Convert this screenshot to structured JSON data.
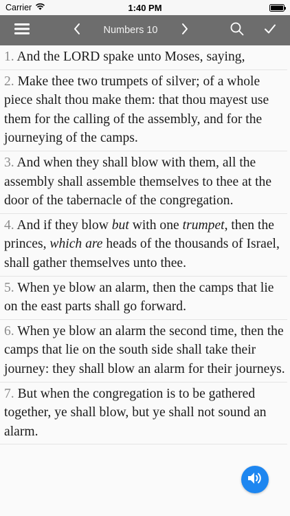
{
  "status_bar": {
    "carrier": "Carrier",
    "time": "1:40 PM"
  },
  "nav": {
    "title": "Numbers 10"
  },
  "verses": [
    {
      "num": "1.",
      "parts": [
        {
          "t": " And the LORD spake unto Moses, saying,"
        }
      ]
    },
    {
      "num": "2.",
      "parts": [
        {
          "t": " Make thee two trumpets of silver; of a whole piece shalt thou make them: that thou mayest use them for the calling of the assembly, and for the journeying of the camps."
        }
      ]
    },
    {
      "num": "3.",
      "parts": [
        {
          "t": " And when they shall blow with them, all the assembly shall assemble themselves to thee at the door of the tabernacle of the congregation."
        }
      ]
    },
    {
      "num": "4.",
      "parts": [
        {
          "t": " And if they blow "
        },
        {
          "t": "but",
          "i": true
        },
        {
          "t": " with one "
        },
        {
          "t": "trumpet",
          "i": true
        },
        {
          "t": ", then the princes, "
        },
        {
          "t": "which are",
          "i": true
        },
        {
          "t": " heads of the thousands of Israel, shall gather themselves unto thee."
        }
      ]
    },
    {
      "num": "5.",
      "parts": [
        {
          "t": " When ye blow an alarm, then the camps that lie on the east parts shall go forward."
        }
      ]
    },
    {
      "num": "6.",
      "parts": [
        {
          "t": " When ye blow an alarm the second time, then the camps that lie on the south side shall take their journey: they shall blow an alarm for their journeys."
        }
      ]
    },
    {
      "num": "7.",
      "parts": [
        {
          "t": " But when the congregation is to be gathered together, ye shall blow, but ye shall not sound an alarm."
        }
      ]
    }
  ],
  "icons": {
    "menu": "menu-icon",
    "prev": "chevron-left-icon",
    "next": "chevron-right-icon",
    "search": "search-icon",
    "done": "checkmark-icon",
    "audio": "speaker-icon",
    "wifi": "wifi-icon",
    "battery": "battery-icon"
  },
  "colors": {
    "nav_bg": "#6d6d6d",
    "audio_button": "#1d86f0",
    "verse_number": "#8c8c8c"
  }
}
